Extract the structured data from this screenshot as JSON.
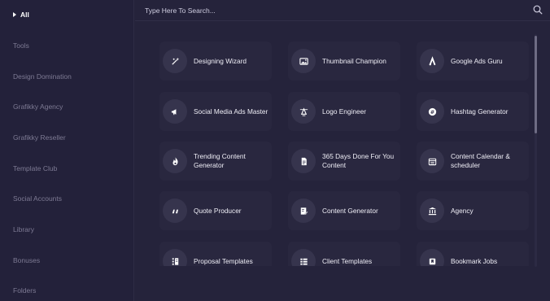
{
  "sidebar": {
    "items": [
      {
        "label": "All",
        "active": true
      },
      {
        "label": "Tools"
      },
      {
        "label": "Design Domination"
      },
      {
        "label": "Grafikky Agency"
      },
      {
        "label": "Grafikky Reseller"
      },
      {
        "label": "Template Club"
      },
      {
        "label": "Social Accounts"
      },
      {
        "label": "Library"
      },
      {
        "label": "Bonuses"
      },
      {
        "label": "Folders"
      }
    ]
  },
  "search": {
    "placeholder": "Type Here To Search..."
  },
  "cards": [
    {
      "label": "Designing Wizard",
      "icon": "wizard-icon"
    },
    {
      "label": "Thumbnail Champion",
      "icon": "image-icon"
    },
    {
      "label": "Google Ads Guru",
      "icon": "google-ads-icon"
    },
    {
      "label": "Social Media Ads Master",
      "icon": "megaphone-icon"
    },
    {
      "label": "Logo Engineer",
      "icon": "logo-icon"
    },
    {
      "label": "Hashtag Generator",
      "icon": "hashtag-icon"
    },
    {
      "label": "Trending Content Generator",
      "icon": "flame-icon"
    },
    {
      "label": "365 Days Done For You Content",
      "icon": "document-icon"
    },
    {
      "label": "Content Calendar & scheduler",
      "icon": "calendar-icon"
    },
    {
      "label": "Quote Producer",
      "icon": "quote-icon"
    },
    {
      "label": "Content Generator",
      "icon": "edit-doc-icon"
    },
    {
      "label": "Agency",
      "icon": "bank-icon"
    },
    {
      "label": "Proposal Templates",
      "icon": "proposal-icon"
    },
    {
      "label": "Client Templates",
      "icon": "list-icon"
    },
    {
      "label": "Bookmark Jobs",
      "icon": "bookmark-icon"
    }
  ],
  "colors": {
    "background": "#24223a",
    "card": "#29273f",
    "icon_circle": "#36344d"
  }
}
